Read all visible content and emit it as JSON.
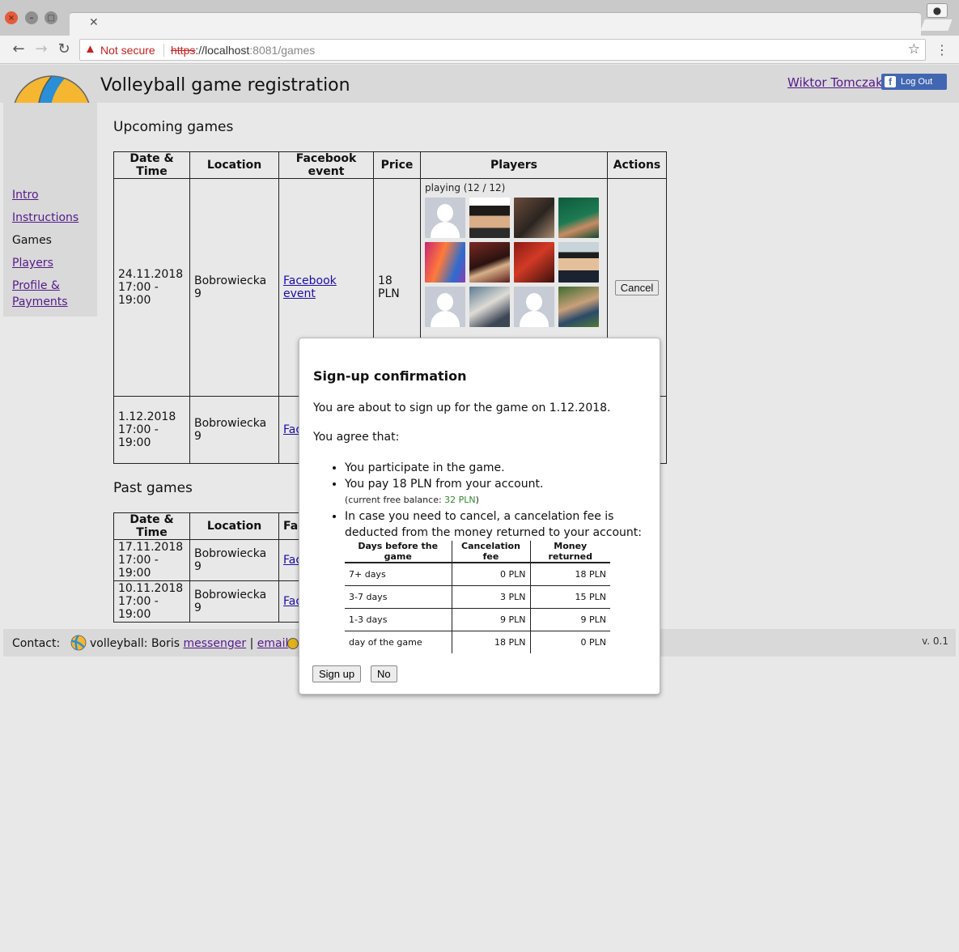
{
  "browser": {
    "warning": "Not secure",
    "url_scheme": "https",
    "url_host": "://localhost",
    "url_rest": ":8081/games"
  },
  "header": {
    "title": "Volleyball game registration",
    "user_name": "Wiktor Tomczak",
    "logout_label": "Log Out"
  },
  "sidebar": {
    "items": [
      {
        "label": "Intro"
      },
      {
        "label": "Instructions"
      },
      {
        "label": "Games"
      },
      {
        "label": "Players"
      },
      {
        "label": "Profile &"
      },
      {
        "label": "Payments"
      }
    ]
  },
  "upcoming": {
    "title": "Upcoming games",
    "columns": [
      "Date & Time",
      "Location",
      "Facebook event",
      "Price",
      "Players",
      "Actions"
    ],
    "rows": [
      {
        "date": "24.11.2018",
        "time": "17:00 - 19:00",
        "location": "Bobrowiecka 9",
        "event": "Facebook event",
        "price": "18 PLN",
        "players_label": "playing (12 / 12)",
        "action": "Cancel"
      },
      {
        "date": "1.12.2018",
        "time": "17:00 - 19:00",
        "location": "Bobrowiecka 9",
        "event": "Fac"
      }
    ]
  },
  "past": {
    "title": "Past games",
    "columns": [
      "Date & Time",
      "Location",
      "Fac"
    ],
    "rows": [
      {
        "date": "17.11.2018",
        "time": "17:00 - 19:00",
        "location": "Bobrowiecka 9",
        "event": "Fac"
      },
      {
        "date": "10.11.2018",
        "time": "17:00 - 19:00",
        "location": "Bobrowiecka 9",
        "event": "Fac"
      }
    ]
  },
  "footer": {
    "contact_label": "Contact:",
    "contact_text": "volleyball: Boris",
    "messenger": "messenger",
    "sep": "|",
    "email": "email",
    "version": "v. 0.1"
  },
  "dialog": {
    "title": "Sign-up confirmation",
    "intro": "You are about to sign up for the game on 1.12.2018.",
    "agree": "You agree that:",
    "bullet1": "You participate in the game.",
    "bullet2": "You pay 18 PLN from your account.",
    "balance_prefix": "(current free balance: ",
    "balance_value": "32 PLN",
    "balance_suffix": ")",
    "bullet3": "In case you need to cancel, a cancelation fee is deducted from the money returned to your account:",
    "fee_columns": [
      "Days before the game",
      "Cancelation fee",
      "Money returned"
    ],
    "fee_rows": [
      [
        "7+ days",
        "0 PLN",
        "18 PLN"
      ],
      [
        "3-7 days",
        "3 PLN",
        "15 PLN"
      ],
      [
        "1-3 days",
        "9 PLN",
        "9 PLN"
      ],
      [
        "day of the game",
        "18 PLN",
        "0 PLN"
      ]
    ],
    "signup_label": "Sign up",
    "no_label": "No"
  },
  "colors": {
    "link": "#551a8b",
    "event_link": "#1a0dab",
    "balance": "#2e8b2e",
    "facebook": "#4267b2"
  }
}
